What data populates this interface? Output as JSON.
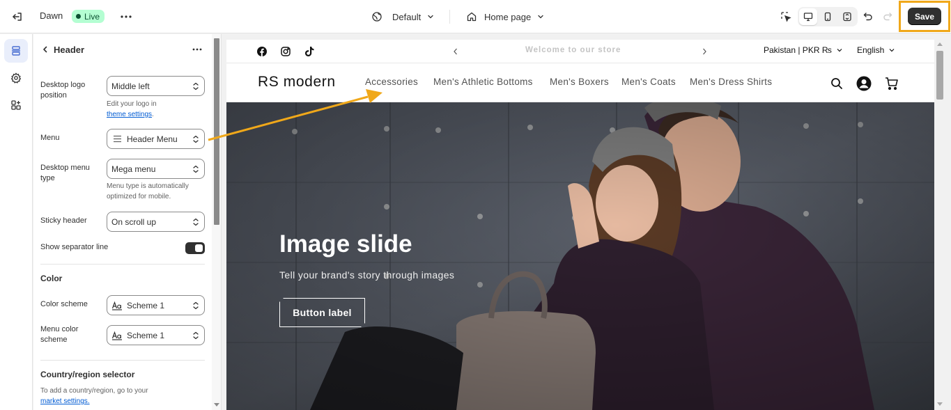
{
  "colors": {
    "accent_highlight": "#f0a81a",
    "live_badge_bg": "#b4fed2",
    "save_button_bg": "#303030",
    "link": "#005bd3"
  },
  "topbar": {
    "theme_name": "Dawn",
    "live_label": "Live",
    "template_selector": "Default",
    "page_selector": "Home page",
    "save_label": "Save"
  },
  "icons": {
    "exit": "exit-icon",
    "more": "more-horizontal-icon",
    "template": "globe-icon",
    "page": "home-icon",
    "inspector": "select-cursor-icon",
    "desktop": "desktop-icon",
    "mobile": "mobile-icon",
    "fullscreen": "fullscreen-icon",
    "undo": "undo-icon",
    "redo": "redo-icon",
    "sections": "sections-icon",
    "settings": "gear-icon",
    "apps": "apps-icon"
  },
  "panel": {
    "title": "Header",
    "fields": {
      "logo_position": {
        "label": "Desktop logo position",
        "value": "Middle left",
        "help_prefix": "Edit your logo in",
        "help_link": "theme settings",
        "help_suffix": "."
      },
      "menu": {
        "label": "Menu",
        "value": "Header Menu"
      },
      "menu_type": {
        "label": "Desktop menu type",
        "value": "Mega menu",
        "help": "Menu type is automatically optimized for mobile."
      },
      "sticky_header": {
        "label": "Sticky header",
        "value": "On scroll up"
      },
      "separator": {
        "label": "Show separator line",
        "enabled": true
      }
    },
    "color_section": {
      "heading": "Color",
      "color_scheme_label": "Color scheme",
      "color_scheme_value": "Scheme 1",
      "menu_color_label": "Menu color scheme",
      "menu_color_value": "Scheme 1"
    },
    "country_section": {
      "heading": "Country/region selector",
      "help": "To add a country/region, go to your",
      "link": "market settings."
    }
  },
  "preview": {
    "announcement": "Welcome to our store",
    "country": "Pakistan | PKR ₨",
    "language": "English",
    "store_name": "RS modern",
    "nav": [
      "Accessories",
      "Men's Athletic Bottoms",
      "Men's Boxers",
      "Men's Coats",
      "Men's Dress Shirts"
    ],
    "hero": {
      "title": "Image slide",
      "subtitle": "Tell your brand's story through images",
      "button": "Button label"
    }
  }
}
